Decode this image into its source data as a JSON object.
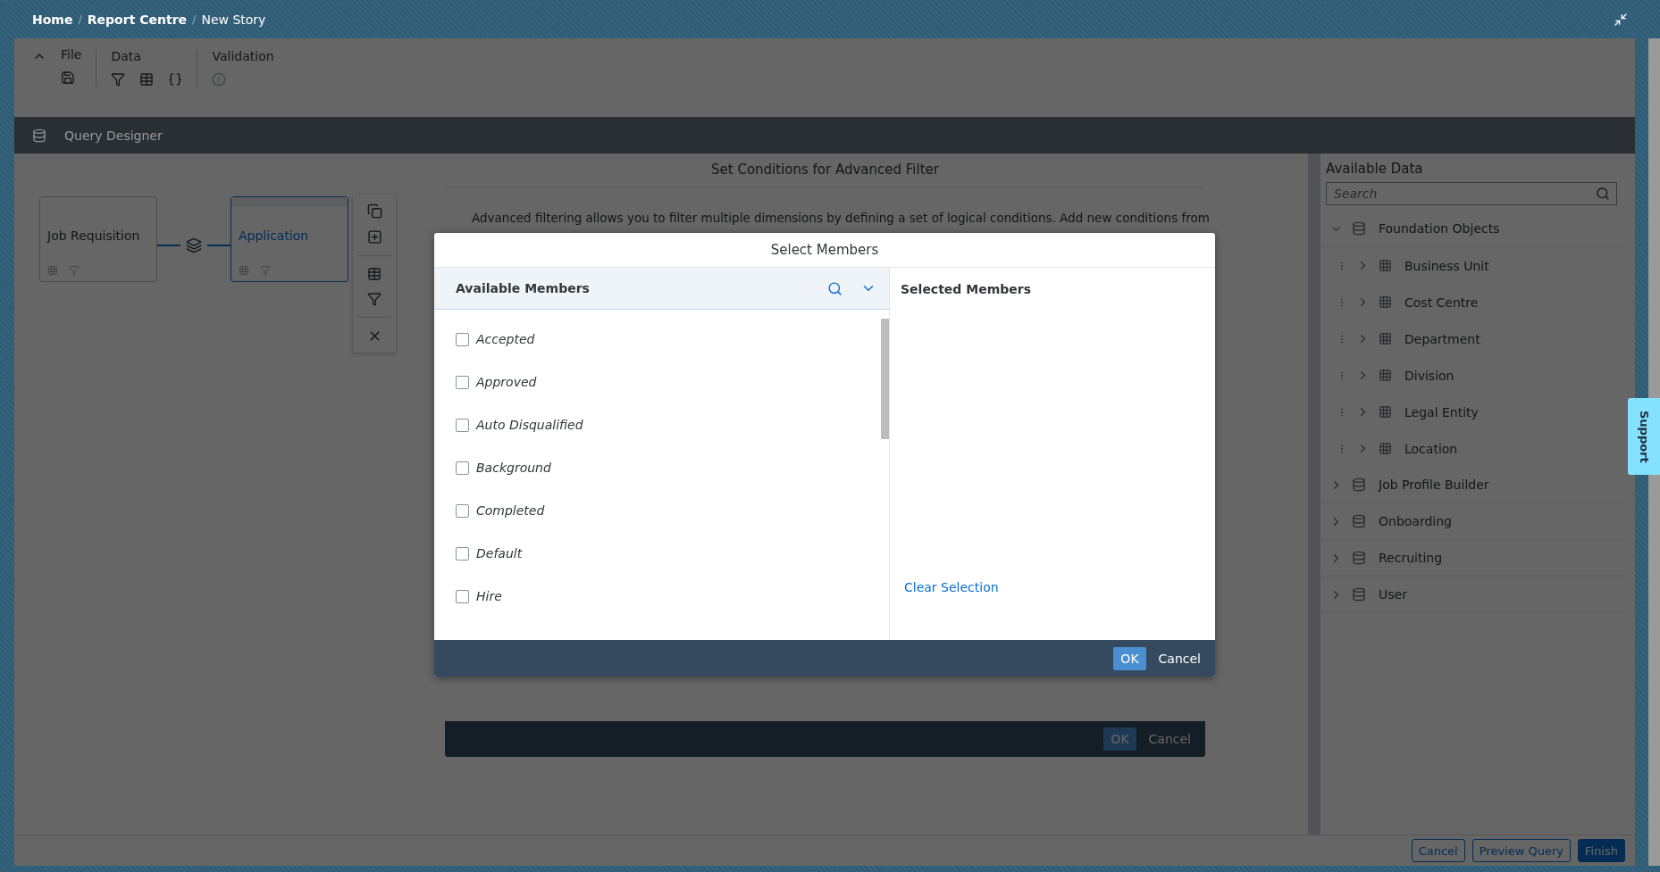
{
  "breadcrumb": {
    "separator": "/",
    "items": [
      {
        "label": "Home"
      },
      {
        "label": "Report Centre"
      },
      {
        "label": "New Story"
      }
    ]
  },
  "toolbar": {
    "groups": [
      {
        "label": "File",
        "tools": [
          {
            "kind": "save"
          }
        ]
      },
      {
        "label": "Data",
        "tools": [
          {
            "kind": "filter"
          },
          {
            "kind": "table"
          },
          {
            "kind": "braces"
          }
        ]
      },
      {
        "label": "Validation",
        "tools": [
          {
            "kind": "alert"
          }
        ]
      }
    ]
  },
  "query_designer": {
    "title": "Query Designer"
  },
  "canvas": {
    "nodes": [
      {
        "label": "Job Requisition",
        "selected": false
      },
      {
        "label": "Application",
        "selected": true
      }
    ],
    "node_tools": [
      {
        "kind": "copy"
      },
      {
        "kind": "add"
      },
      {
        "kind": "table"
      },
      {
        "kind": "filter"
      },
      {
        "kind": "close"
      }
    ]
  },
  "available_data": {
    "title": "Available Data",
    "search": {
      "placeholder": "Search"
    },
    "tree": [
      {
        "label": "Foundation Objects",
        "expanded": true,
        "children": [
          {
            "label": "Business Unit",
            "expanded": false
          },
          {
            "label": "Cost Centre",
            "expanded": false
          },
          {
            "label": "Department",
            "expanded": false
          },
          {
            "label": "Division",
            "expanded": false
          },
          {
            "label": "Legal Entity",
            "expanded": false
          },
          {
            "label": "Location",
            "expanded": false
          }
        ]
      },
      {
        "label": "Job Profile Builder",
        "expanded": false
      },
      {
        "label": "Onboarding",
        "expanded": false
      },
      {
        "label": "Recruiting",
        "expanded": false
      },
      {
        "label": "User",
        "expanded": false
      }
    ]
  },
  "support": {
    "label": "Support"
  },
  "footer_buttons": [
    {
      "label": "Cancel",
      "kind": "secondary"
    },
    {
      "label": "Preview Query",
      "kind": "secondary"
    },
    {
      "label": "Finish",
      "kind": "primary"
    }
  ],
  "advanced_filter_dialog": {
    "title": "Set Conditions for Advanced Filter",
    "info": "Advanced filtering allows you to filter multiple dimensions by defining a set of logical conditions. Add new conditions from",
    "buttons": [
      {
        "label": "OK",
        "kind": "primary"
      },
      {
        "label": "Cancel",
        "kind": "secondary"
      }
    ]
  },
  "select_members_dialog": {
    "title": "Select Members",
    "available_title": "Available Members",
    "members": [
      {
        "label": "Accepted",
        "checked": false
      },
      {
        "label": "Approved",
        "checked": false
      },
      {
        "label": "Auto Disqualified",
        "checked": false
      },
      {
        "label": "Background",
        "checked": false
      },
      {
        "label": "Completed",
        "checked": false
      },
      {
        "label": "Default",
        "checked": false
      },
      {
        "label": "Hire",
        "checked": false
      }
    ],
    "selected_title": "Selected Members",
    "clear_selection": "Clear Selection",
    "buttons": [
      {
        "label": "OK",
        "kind": "primary"
      },
      {
        "label": "Cancel",
        "kind": "secondary"
      }
    ]
  }
}
